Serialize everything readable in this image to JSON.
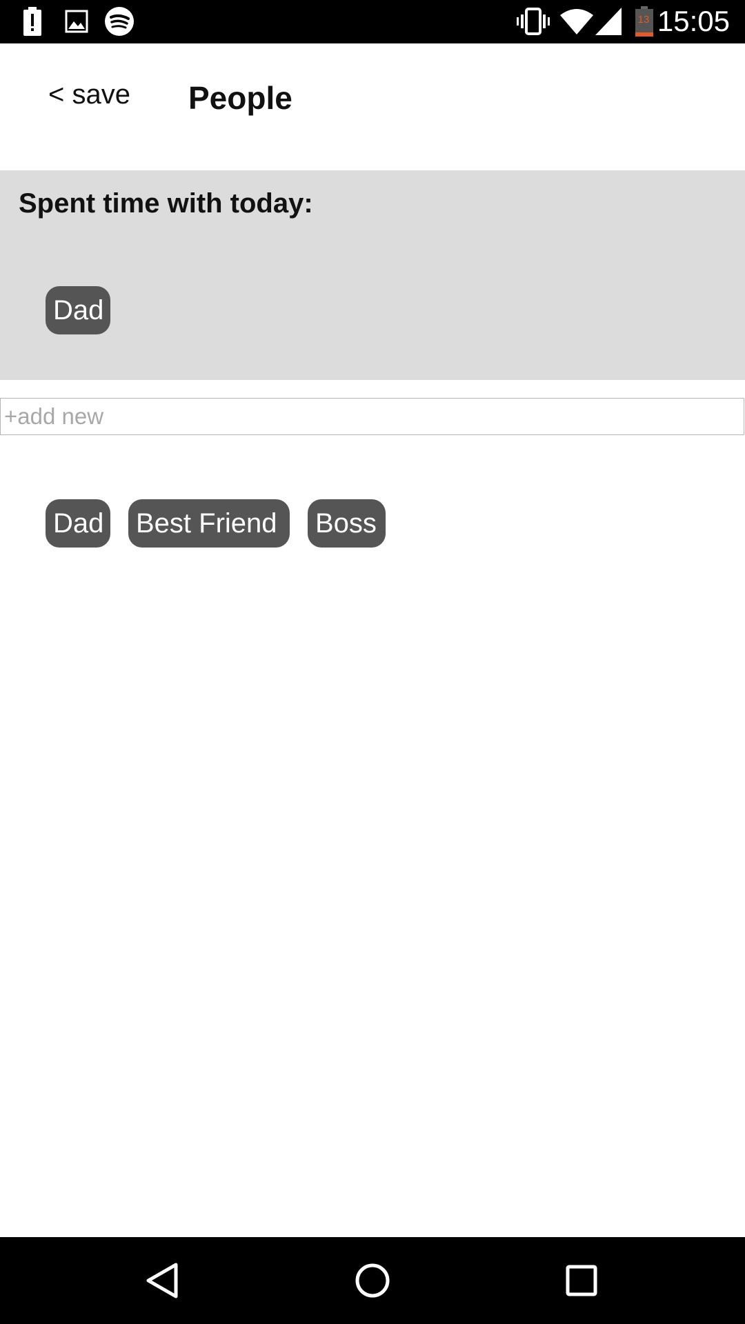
{
  "status_bar": {
    "time": "15:05",
    "battery_level": "13",
    "icons": [
      "battery-alert-icon",
      "image-icon",
      "spotify-icon",
      "vibrate-icon",
      "wifi-icon",
      "cell-signal-icon",
      "battery-icon"
    ]
  },
  "header": {
    "back_label": "< save",
    "title": "People"
  },
  "today": {
    "heading": "Spent time with today:",
    "people": [
      "Dad"
    ]
  },
  "add_new": {
    "placeholder": "+add new",
    "value": ""
  },
  "people_list": [
    "Dad",
    "Best Friend",
    "Boss"
  ],
  "nav": {
    "icons": [
      "back-icon",
      "home-icon",
      "recents-icon"
    ]
  },
  "colors": {
    "chip_bg": "#555555",
    "panel_bg": "#dcdcdc",
    "battery_low": "#e05a2b"
  }
}
